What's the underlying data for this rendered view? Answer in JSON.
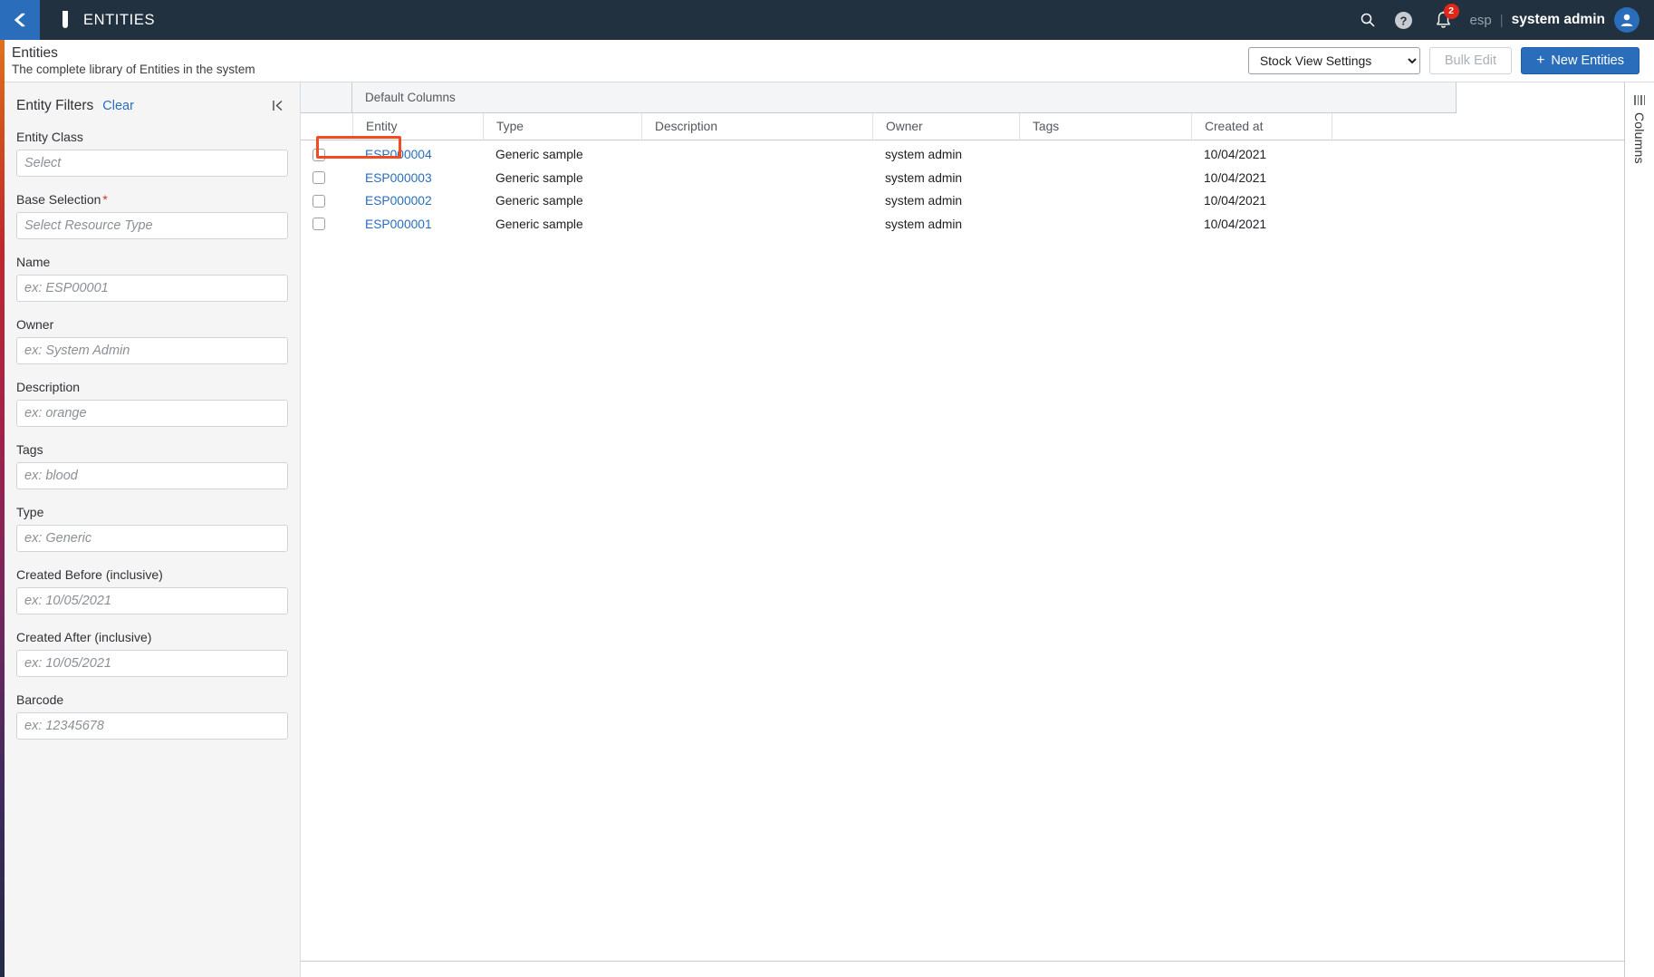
{
  "topbar": {
    "back_icon": "chevron-left-icon",
    "app_icon": "test-tube-icon",
    "app_title": "ENTITIES",
    "search_icon": "search-icon",
    "help_icon": "help-circle-icon",
    "notifications_icon": "bell-icon",
    "notifications_count": "2",
    "tenant": "esp",
    "separator": "|",
    "username": "system admin",
    "avatar_icon": "user-avatar-icon",
    "accent_blue": "#2a6ebb",
    "bar_color": "#22313f"
  },
  "page": {
    "title": "Entities",
    "subtitle": "The complete library of Entities in the system"
  },
  "toolbar": {
    "view_settings_value": "Stock View Settings",
    "view_settings_options": [
      "Stock View Settings"
    ],
    "bulk_edit_label": "Bulk Edit",
    "new_entities_label": "New Entities",
    "new_entities_plus": "+"
  },
  "filters": {
    "title": "Entity Filters",
    "clear_label": "Clear",
    "collapse_icon": "collapse-panel-icon",
    "fields": [
      {
        "label": "Entity Class",
        "placeholder": "Select",
        "value": "",
        "type": "select",
        "required": false
      },
      {
        "label": "Base Selection",
        "placeholder": "Select Resource Type",
        "value": "",
        "type": "select",
        "required": true
      },
      {
        "label": "Name",
        "placeholder": "ex: ESP00001",
        "value": "",
        "type": "text",
        "required": false
      },
      {
        "label": "Owner",
        "placeholder": "ex: System Admin",
        "value": "",
        "type": "text",
        "required": false
      },
      {
        "label": "Description",
        "placeholder": "ex: orange",
        "value": "",
        "type": "text",
        "required": false
      },
      {
        "label": "Tags",
        "placeholder": "ex: blood",
        "value": "",
        "type": "text",
        "required": false
      },
      {
        "label": "Type",
        "placeholder": "ex: Generic",
        "value": "",
        "type": "text",
        "required": false
      },
      {
        "label": "Created Before (inclusive)",
        "placeholder": "ex: 10/05/2021",
        "value": "",
        "type": "text",
        "required": false
      },
      {
        "label": "Created After (inclusive)",
        "placeholder": "ex: 10/05/2021",
        "value": "",
        "type": "text",
        "required": false
      },
      {
        "label": "Barcode",
        "placeholder": "ex: 12345678",
        "value": "",
        "type": "text",
        "required": false
      }
    ]
  },
  "grid": {
    "group_header": "Default Columns",
    "columns": [
      "Entity",
      "Type",
      "Description",
      "Owner",
      "Tags",
      "Created at"
    ],
    "rows": [
      {
        "entity": "ESP000004",
        "type": "Generic sample",
        "description": "",
        "owner": "system admin",
        "tags": "",
        "created_at": "10/04/2021",
        "checked": false,
        "highlighted": true
      },
      {
        "entity": "ESP000003",
        "type": "Generic sample",
        "description": "",
        "owner": "system admin",
        "tags": "",
        "created_at": "10/04/2021",
        "checked": false,
        "highlighted": false
      },
      {
        "entity": "ESP000002",
        "type": "Generic sample",
        "description": "",
        "owner": "system admin",
        "tags": "",
        "created_at": "10/04/2021",
        "checked": false,
        "highlighted": false
      },
      {
        "entity": "ESP000001",
        "type": "Generic sample",
        "description": "",
        "owner": "system admin",
        "tags": "",
        "created_at": "10/04/2021",
        "checked": false,
        "highlighted": false
      }
    ],
    "highlight_color": "#f04b23"
  },
  "columns_rail": {
    "label": "Columns",
    "grip_icon": "grip-lines-vertical-icon"
  }
}
